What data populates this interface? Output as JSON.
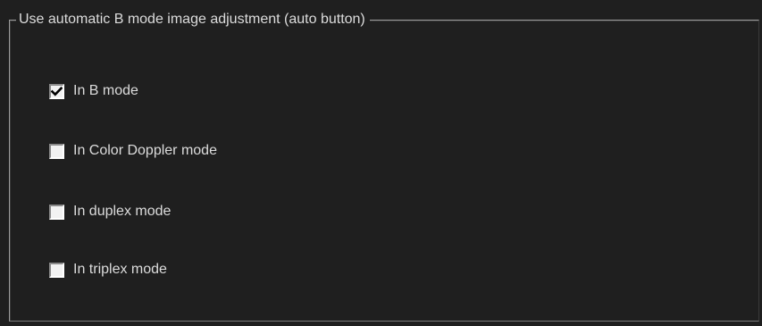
{
  "group": {
    "title": "Use automatic B mode image adjustment (auto button)"
  },
  "options": [
    {
      "label": "In B mode",
      "checked": true
    },
    {
      "label": "In Color Doppler mode",
      "checked": false
    },
    {
      "label": "In duplex mode",
      "checked": false
    },
    {
      "label": "In triplex mode",
      "checked": false
    }
  ],
  "colors": {
    "background": "#1f1f1f",
    "text": "#dcdcdc",
    "checkbox_fill": "#f2f2f2",
    "checkmark": "#000000"
  }
}
